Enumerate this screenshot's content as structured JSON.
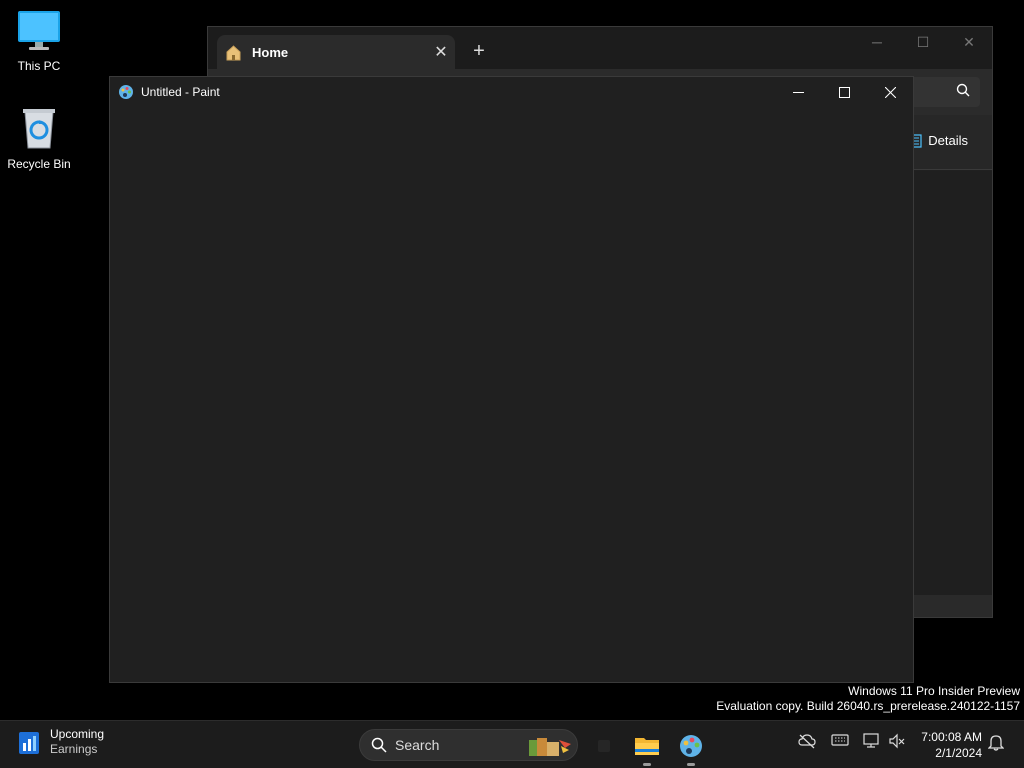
{
  "desktop": {
    "icons": [
      {
        "label": "This PC"
      },
      {
        "label": "Recycle Bin"
      }
    ]
  },
  "explorer": {
    "tab_title": "Home",
    "details_label": "Details"
  },
  "paint": {
    "title": "Untitled - Paint"
  },
  "watermark": {
    "line1": "Windows 11 Pro Insider Preview",
    "line2": "Evaluation copy. Build 26040.rs_prerelease.240122-1157"
  },
  "taskbar": {
    "widget_title": "Upcoming",
    "widget_subtitle": "Earnings",
    "search_placeholder": "Search",
    "time": "7:00:08 AM",
    "date": "2/1/2024"
  },
  "colors": {
    "accent": "#0078d4",
    "window_bg": "#202020",
    "taskbar_bg": "#1c1c1c"
  }
}
